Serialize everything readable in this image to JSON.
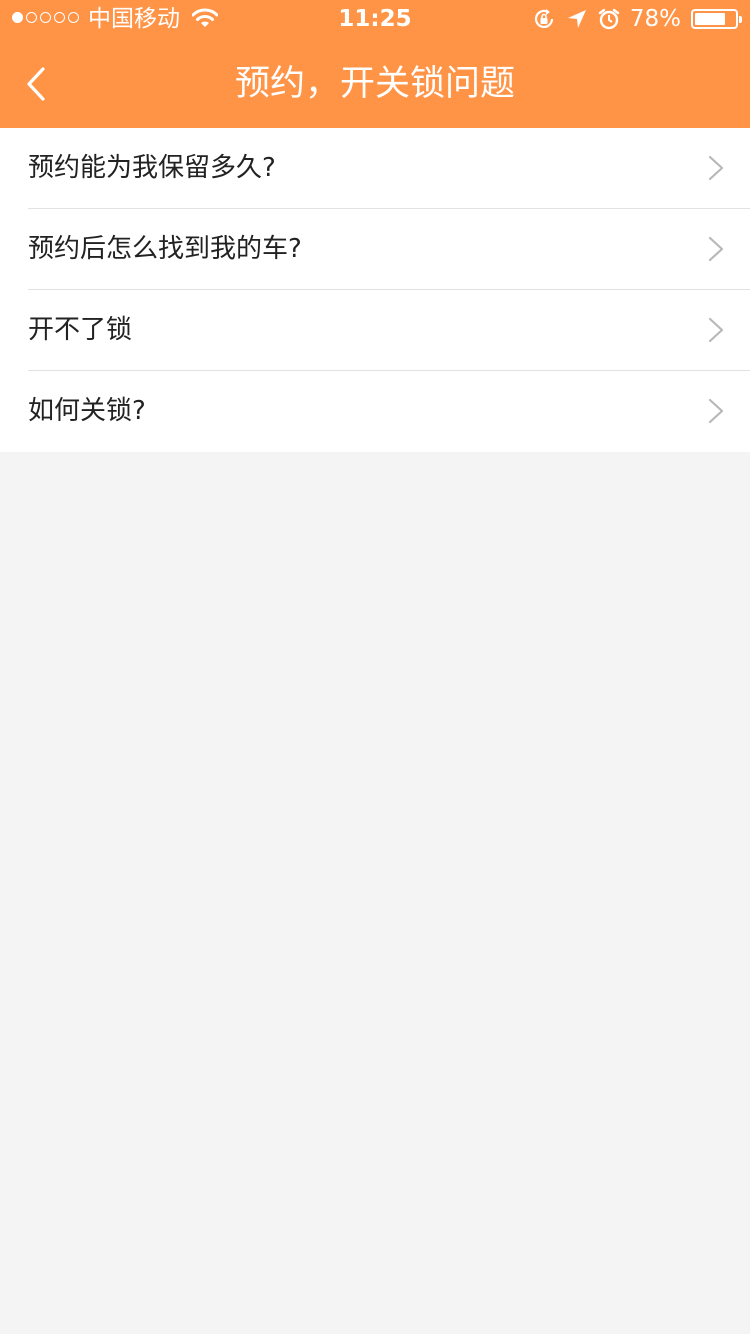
{
  "status_bar": {
    "carrier": "中国移动",
    "time": "11:25",
    "battery_percent": "78%",
    "battery_level": 0.78,
    "signal_dots_filled": 1,
    "icons": [
      "signal-dots-icon",
      "wifi-icon",
      "rotation-lock-icon",
      "location-arrow-icon",
      "alarm-clock-icon",
      "battery-icon"
    ]
  },
  "nav": {
    "title": "预约，开关锁问题",
    "back_icon": "chevron-left-icon"
  },
  "faq": {
    "items": [
      {
        "label": "预约能为我保留多久?"
      },
      {
        "label": "预约后怎么找到我的车?"
      },
      {
        "label": "开不了锁"
      },
      {
        "label": "如何关锁?"
      }
    ],
    "item_icon": "chevron-right-icon"
  },
  "colors": {
    "header": "#ff9447",
    "background": "#f4f4f4",
    "list_background": "#ffffff",
    "divider": "#e2e2e2",
    "chevron": "#b8b8b8"
  }
}
